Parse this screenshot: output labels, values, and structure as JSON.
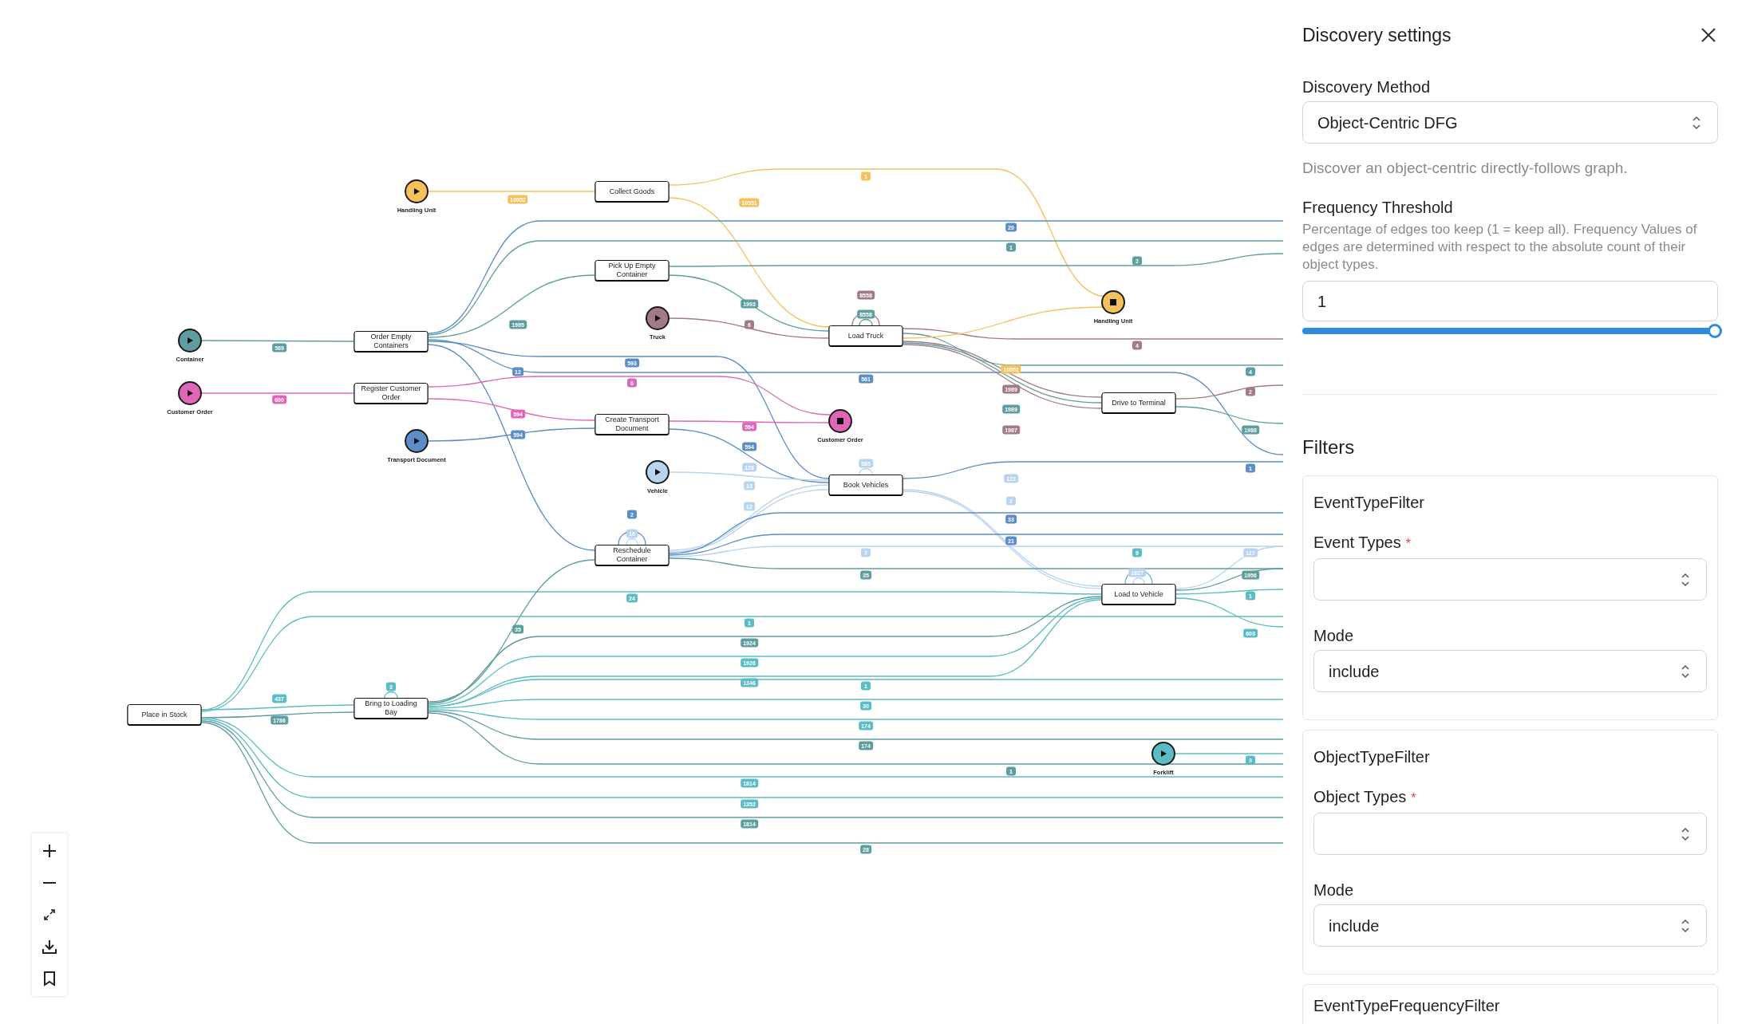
{
  "graph": {
    "terminal_nodes": [
      {
        "label": "Handling Unit",
        "kind": "start",
        "color": "#f5c15c"
      },
      {
        "label": "Container",
        "kind": "start",
        "color": "#5f9ea0"
      },
      {
        "label": "Customer Order",
        "kind": "start",
        "color": "#e066b8"
      },
      {
        "label": "Transport Document",
        "kind": "start",
        "color": "#5b8ec6"
      },
      {
        "label": "Truck",
        "kind": "start",
        "color": "#a27b89"
      },
      {
        "label": "Vehicle",
        "kind": "start",
        "color": "#b8d4ef"
      },
      {
        "label": "Forklift",
        "kind": "start",
        "color": "#5cbcc4"
      },
      {
        "label": "Customer Order",
        "kind": "end",
        "color": "#e066b8"
      },
      {
        "label": "Handling Unit",
        "kind": "end",
        "color": "#f5c15c"
      }
    ],
    "activities": [
      {
        "label": "Collect Goods"
      },
      {
        "label": "Pick Up Empty Container"
      },
      {
        "label": "Order Empty Containers"
      },
      {
        "label": "Register Customer Order"
      },
      {
        "label": "Create Transport Document"
      },
      {
        "label": "Load Truck"
      },
      {
        "label": "Drive to Terminal"
      },
      {
        "label": "Book Vehicles"
      },
      {
        "label": "Reschedule Container"
      },
      {
        "label": "Load to Vehicle"
      },
      {
        "label": "Place in Stock"
      },
      {
        "label": "Bring to Loading Bay"
      }
    ],
    "edges": [
      {
        "count": "10552",
        "color": "#f5c15c"
      },
      {
        "count": "10551",
        "color": "#f5c15c"
      },
      {
        "count": "1",
        "color": "#f5c15c"
      },
      {
        "count": "20",
        "color": "#5b8ec6"
      },
      {
        "count": "1",
        "color": "#5f9ea0"
      },
      {
        "count": "2",
        "color": "#5f9ea0"
      },
      {
        "count": "1993",
        "color": "#5f9ea0"
      },
      {
        "count": "1995",
        "color": "#5f9ea0"
      },
      {
        "count": "589",
        "color": "#5f9ea0"
      },
      {
        "count": "6",
        "color": "#a27b89"
      },
      {
        "count": "8558",
        "color": "#a27b89"
      },
      {
        "count": "8558",
        "color": "#5f9ea0"
      },
      {
        "count": "4",
        "color": "#a27b89"
      },
      {
        "count": "593",
        "color": "#5b8ec6"
      },
      {
        "count": "12",
        "color": "#5b8ec6"
      },
      {
        "count": "4",
        "color": "#5f9ea0"
      },
      {
        "count": "10551",
        "color": "#f5c15c"
      },
      {
        "count": "561",
        "color": "#5b8ec6"
      },
      {
        "count": "6",
        "color": "#e066b8"
      },
      {
        "count": "600",
        "color": "#e066b8"
      },
      {
        "count": "2",
        "color": "#a27b89"
      },
      {
        "count": "1989",
        "color": "#a27b89"
      },
      {
        "count": "594",
        "color": "#e066b8"
      },
      {
        "count": "1989",
        "color": "#5f9ea0"
      },
      {
        "count": "594",
        "color": "#e066b8"
      },
      {
        "count": "1987",
        "color": "#a27b89"
      },
      {
        "count": "1988",
        "color": "#5f9ea0"
      },
      {
        "count": "594",
        "color": "#5b8ec6"
      },
      {
        "count": "594",
        "color": "#5b8ec6"
      },
      {
        "count": "1",
        "color": "#5b8ec6"
      },
      {
        "count": "585",
        "color": "#b8d4ef"
      },
      {
        "count": "128",
        "color": "#b8d4ef"
      },
      {
        "count": "122",
        "color": "#b8d4ef"
      },
      {
        "count": "13",
        "color": "#b8d4ef"
      },
      {
        "count": "2",
        "color": "#b8d4ef"
      },
      {
        "count": "12",
        "color": "#b8d4ef"
      },
      {
        "count": "2",
        "color": "#5b8ec6"
      },
      {
        "count": "33",
        "color": "#5b8ec6"
      },
      {
        "count": "10",
        "color": "#b8d4ef"
      },
      {
        "count": "21",
        "color": "#5b8ec6"
      },
      {
        "count": "7",
        "color": "#b8d4ef"
      },
      {
        "count": "9",
        "color": "#5cbcc4"
      },
      {
        "count": "127",
        "color": "#b8d4ef"
      },
      {
        "count": "1827",
        "color": "#b8d4ef"
      },
      {
        "count": "35",
        "color": "#5f9ea0"
      },
      {
        "count": "1956",
        "color": "#5f9ea0"
      },
      {
        "count": "1",
        "color": "#5cbcc4"
      },
      {
        "count": "24",
        "color": "#5cbcc4"
      },
      {
        "count": "35",
        "color": "#5f9ea0"
      },
      {
        "count": "1",
        "color": "#5cbcc4"
      },
      {
        "count": "603",
        "color": "#5cbcc4"
      },
      {
        "count": "1924",
        "color": "#5f9ea0"
      },
      {
        "count": "1926",
        "color": "#5cbcc4"
      },
      {
        "count": "1346",
        "color": "#5cbcc4"
      },
      {
        "count": "3",
        "color": "#5cbcc4"
      },
      {
        "count": "1",
        "color": "#5cbcc4"
      },
      {
        "count": "437",
        "color": "#5cbcc4"
      },
      {
        "count": "30",
        "color": "#5cbcc4"
      },
      {
        "count": "1786",
        "color": "#5f9ea0"
      },
      {
        "count": "174",
        "color": "#5cbcc4"
      },
      {
        "count": "174",
        "color": "#5f9ea0"
      },
      {
        "count": "3",
        "color": "#5cbcc4"
      },
      {
        "count": "1",
        "color": "#5f9ea0"
      },
      {
        "count": "1814",
        "color": "#5cbcc4"
      },
      {
        "count": "1352",
        "color": "#5cbcc4"
      },
      {
        "count": "1814",
        "color": "#5f9ea0"
      },
      {
        "count": "28",
        "color": "#5f9ea0"
      }
    ]
  },
  "settings": {
    "title": "Discovery settings",
    "discovery_method": {
      "label": "Discovery Method",
      "value": "Object-Centric DFG",
      "hint": "Discover an object-centric directly-follows graph."
    },
    "frequency_threshold": {
      "label": "Frequency Threshold",
      "description": "Percentage of edges too keep (1 = keep all). Frequency Values of edges are determined with respect to the absolute count of their object types.",
      "value": "1",
      "level": 1
    },
    "filters_heading": "Filters",
    "filters": [
      {
        "title": "EventTypeFilter",
        "fields": [
          {
            "label": "Event Types",
            "required_mark": "*"
          },
          {
            "label": "Mode",
            "value": "include"
          }
        ]
      },
      {
        "title": "ObjectTypeFilter",
        "fields": [
          {
            "label": "Object Types",
            "required_mark": "*"
          },
          {
            "label": "Mode",
            "value": "include"
          }
        ]
      },
      {
        "title": "EventTypeFrequencyFilter"
      }
    ]
  }
}
